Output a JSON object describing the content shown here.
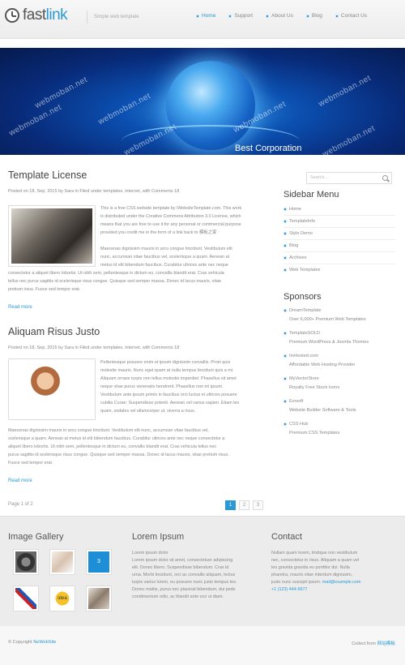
{
  "header": {
    "logo_left": "fast",
    "logo_right": "link",
    "tagline": "Simple web template",
    "nav": [
      {
        "label": "Home",
        "active": true
      },
      {
        "label": "Support"
      },
      {
        "label": "About Us"
      },
      {
        "label": "Blog"
      },
      {
        "label": "Contact Us"
      }
    ]
  },
  "banner": {
    "caption": "Best Corporation",
    "watermark": "webmoban.net"
  },
  "posts": [
    {
      "title": "Template License",
      "meta": "Posted on 18, Sep, 2015 by Sara in Filed under templates, internet, with Comments 18",
      "para1": [
        "This is a free CSS website template by iWebsiteTemplate.com. This work",
        "is distributed under the Creative Commons Attribution 3.0 License, which",
        "means that you are free to use it for any personal or commercial purpose",
        "provided you credit me in the form of a link back to 模板之家"
      ],
      "para2": [
        "Maecenas dignissim mauris in arcu congue tincidunt. Vestibulum elit",
        "nunc, accumsan vitae faucibus vel, scelerisque a quam. Aenean at",
        "metus id elit bibendum faucibus. Curabitur ultrices ante nec neque",
        "consectetur a aliquet libero lobortis. Ut nibh sem, pellentesque in dictum eu, convallis blandit erat. Cras vehicula",
        "tellus nec purus sagittis id scelerisque risus congue. Quisque sed semper massa. Donec id lacus mauris, vitae",
        "pretium risus. Fusce sed tempor erat."
      ],
      "read_more": "Read more"
    },
    {
      "title": "Aliquam Risus Justo",
      "meta": "Posted on 18, Sep, 2015 by Sara in Filed under templates, internet, with Comments 18",
      "para1": [
        "Pellentesque posuere enim et ipsum dignissim convallis. Proin quis",
        "molestie mauris. Nunc eget quam at nulla tempus tincidunt quis a mi.",
        "Aliquam ornare turpis non tellus molestie imperdiet. Phasellus sit amet",
        "neque vitae purus venenatis hendrerit. Phasellus non mi ipsum.",
        "Vestibulum ante ipsum primis in faucibus orci luctus et ultrices posuere",
        "cubilia Curae; Suspendisse potenti. Aenean vel varius sapien. Etiam leo",
        "quam, sodales vel ullamcorper ut, viverra a risus."
      ],
      "para2": [
        "Maecenas dignissim mauris in arcu congue tincidunt. Vestibulum elit nunc, accumsan vitae faucibus vel,",
        "scelerisque a quam. Aenean at metus id elit bibendum faucibus. Curabitur ultrices ante nec neque consectetur a",
        "aliquet libero lobortis. Ut nibh sem, pellentesque in dictum eu, convallis blandit erat. Cras vehicula tellus nec",
        "purus sagittis id scelerisque risus congue. Quisque sed semper massa. Donec id lacus mauris, vitae pretium risus.",
        "Fusce sed tempor erat."
      ],
      "read_more": "Read more"
    }
  ],
  "pagination": {
    "info": "Page 1 of 2",
    "pages": [
      "1",
      "2",
      "3"
    ],
    "current": "1"
  },
  "sidebar": {
    "search_placeholder": "Search...",
    "menu_title": "Sidebar Menu",
    "menu": [
      "Home",
      "TemplateInfo",
      "Style Demo",
      "Blog",
      "Archives",
      "Web Templates"
    ],
    "sponsors_title": "Sponsors",
    "sponsors": [
      {
        "name": "DreamTemplate",
        "desc": "Over 6,000+ Premium Web Templates"
      },
      {
        "name": "TemplateSOLD",
        "desc": "Premium WordPress & Joomla Themes"
      },
      {
        "name": "ImHosted.com",
        "desc": "Affordable Web Hosting Provider"
      },
      {
        "name": "MyVectorStore",
        "desc": "Royalty Free Stock Icons"
      },
      {
        "name": "Evrsoft",
        "desc": "Website Builder Software & Tools"
      },
      {
        "name": "CSS Hub",
        "desc": "Premium CSS Templates"
      }
    ]
  },
  "footer": {
    "gallery_title": "Image Gallery",
    "gallery_labels": [
      "",
      "",
      "3",
      "",
      "idea",
      ""
    ],
    "lorem_title": "Lorem Ipsum",
    "lorem_lines": [
      "Lorem ipsum dolor",
      "Lorem ipsum dolor sit amet, consectetuer adipiscing",
      "elit. Donec libero. Suspendisse bibendum. Cras id",
      "urna. Morbi tincidunt, orci ac convallis aliquam, lectus",
      "turpis varius lorem, eu posuere nunc justo tempus leo.",
      "Donec mattis, purus nec placerat bibendum, dui pede",
      "condimentum odio, ac blandit ante orci ut diam."
    ],
    "contact_title": "Contact",
    "contact_lines": [
      "Nullam quam lorem, tristique non vestibulum",
      "nec, consectetur in risus. Aliquam a quam vel",
      "leo gravida gravida eu porttitor dui. Nulla",
      "pharetra, mauris vitae interdum dignissim,",
      "justo nunc suscipit ipsum."
    ],
    "contact_email": "mail@example.com",
    "contact_phone": "+1 (123) 444-5677"
  },
  "bottom": {
    "copyright_prefix": "© Copyright",
    "copyright_link": "NeWebSite",
    "collect_prefix": "Collect from",
    "collect_link": "网站模板"
  }
}
